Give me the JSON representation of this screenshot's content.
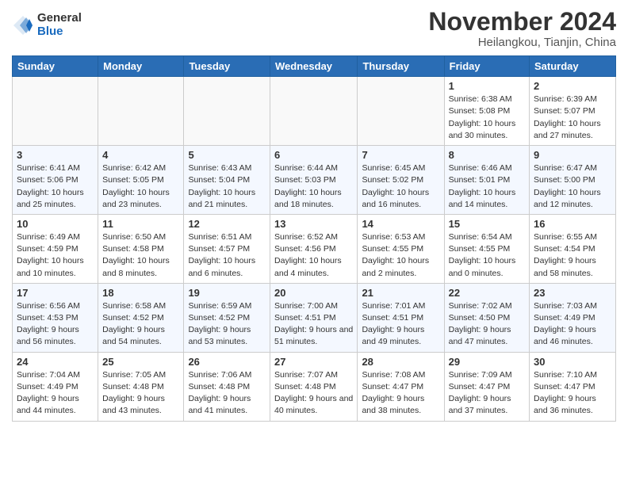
{
  "logo": {
    "general": "General",
    "blue": "Blue"
  },
  "title": "November 2024",
  "location": "Heilangkou, Tianjin, China",
  "columns": [
    "Sunday",
    "Monday",
    "Tuesday",
    "Wednesday",
    "Thursday",
    "Friday",
    "Saturday"
  ],
  "weeks": [
    [
      {
        "day": "",
        "info": ""
      },
      {
        "day": "",
        "info": ""
      },
      {
        "day": "",
        "info": ""
      },
      {
        "day": "",
        "info": ""
      },
      {
        "day": "",
        "info": ""
      },
      {
        "day": "1",
        "info": "Sunrise: 6:38 AM\nSunset: 5:08 PM\nDaylight: 10 hours and 30 minutes."
      },
      {
        "day": "2",
        "info": "Sunrise: 6:39 AM\nSunset: 5:07 PM\nDaylight: 10 hours and 27 minutes."
      }
    ],
    [
      {
        "day": "3",
        "info": "Sunrise: 6:41 AM\nSunset: 5:06 PM\nDaylight: 10 hours and 25 minutes."
      },
      {
        "day": "4",
        "info": "Sunrise: 6:42 AM\nSunset: 5:05 PM\nDaylight: 10 hours and 23 minutes."
      },
      {
        "day": "5",
        "info": "Sunrise: 6:43 AM\nSunset: 5:04 PM\nDaylight: 10 hours and 21 minutes."
      },
      {
        "day": "6",
        "info": "Sunrise: 6:44 AM\nSunset: 5:03 PM\nDaylight: 10 hours and 18 minutes."
      },
      {
        "day": "7",
        "info": "Sunrise: 6:45 AM\nSunset: 5:02 PM\nDaylight: 10 hours and 16 minutes."
      },
      {
        "day": "8",
        "info": "Sunrise: 6:46 AM\nSunset: 5:01 PM\nDaylight: 10 hours and 14 minutes."
      },
      {
        "day": "9",
        "info": "Sunrise: 6:47 AM\nSunset: 5:00 PM\nDaylight: 10 hours and 12 minutes."
      }
    ],
    [
      {
        "day": "10",
        "info": "Sunrise: 6:49 AM\nSunset: 4:59 PM\nDaylight: 10 hours and 10 minutes."
      },
      {
        "day": "11",
        "info": "Sunrise: 6:50 AM\nSunset: 4:58 PM\nDaylight: 10 hours and 8 minutes."
      },
      {
        "day": "12",
        "info": "Sunrise: 6:51 AM\nSunset: 4:57 PM\nDaylight: 10 hours and 6 minutes."
      },
      {
        "day": "13",
        "info": "Sunrise: 6:52 AM\nSunset: 4:56 PM\nDaylight: 10 hours and 4 minutes."
      },
      {
        "day": "14",
        "info": "Sunrise: 6:53 AM\nSunset: 4:55 PM\nDaylight: 10 hours and 2 minutes."
      },
      {
        "day": "15",
        "info": "Sunrise: 6:54 AM\nSunset: 4:55 PM\nDaylight: 10 hours and 0 minutes."
      },
      {
        "day": "16",
        "info": "Sunrise: 6:55 AM\nSunset: 4:54 PM\nDaylight: 9 hours and 58 minutes."
      }
    ],
    [
      {
        "day": "17",
        "info": "Sunrise: 6:56 AM\nSunset: 4:53 PM\nDaylight: 9 hours and 56 minutes."
      },
      {
        "day": "18",
        "info": "Sunrise: 6:58 AM\nSunset: 4:52 PM\nDaylight: 9 hours and 54 minutes."
      },
      {
        "day": "19",
        "info": "Sunrise: 6:59 AM\nSunset: 4:52 PM\nDaylight: 9 hours and 53 minutes."
      },
      {
        "day": "20",
        "info": "Sunrise: 7:00 AM\nSunset: 4:51 PM\nDaylight: 9 hours and 51 minutes."
      },
      {
        "day": "21",
        "info": "Sunrise: 7:01 AM\nSunset: 4:51 PM\nDaylight: 9 hours and 49 minutes."
      },
      {
        "day": "22",
        "info": "Sunrise: 7:02 AM\nSunset: 4:50 PM\nDaylight: 9 hours and 47 minutes."
      },
      {
        "day": "23",
        "info": "Sunrise: 7:03 AM\nSunset: 4:49 PM\nDaylight: 9 hours and 46 minutes."
      }
    ],
    [
      {
        "day": "24",
        "info": "Sunrise: 7:04 AM\nSunset: 4:49 PM\nDaylight: 9 hours and 44 minutes."
      },
      {
        "day": "25",
        "info": "Sunrise: 7:05 AM\nSunset: 4:48 PM\nDaylight: 9 hours and 43 minutes."
      },
      {
        "day": "26",
        "info": "Sunrise: 7:06 AM\nSunset: 4:48 PM\nDaylight: 9 hours and 41 minutes."
      },
      {
        "day": "27",
        "info": "Sunrise: 7:07 AM\nSunset: 4:48 PM\nDaylight: 9 hours and 40 minutes."
      },
      {
        "day": "28",
        "info": "Sunrise: 7:08 AM\nSunset: 4:47 PM\nDaylight: 9 hours and 38 minutes."
      },
      {
        "day": "29",
        "info": "Sunrise: 7:09 AM\nSunset: 4:47 PM\nDaylight: 9 hours and 37 minutes."
      },
      {
        "day": "30",
        "info": "Sunrise: 7:10 AM\nSunset: 4:47 PM\nDaylight: 9 hours and 36 minutes."
      }
    ]
  ]
}
